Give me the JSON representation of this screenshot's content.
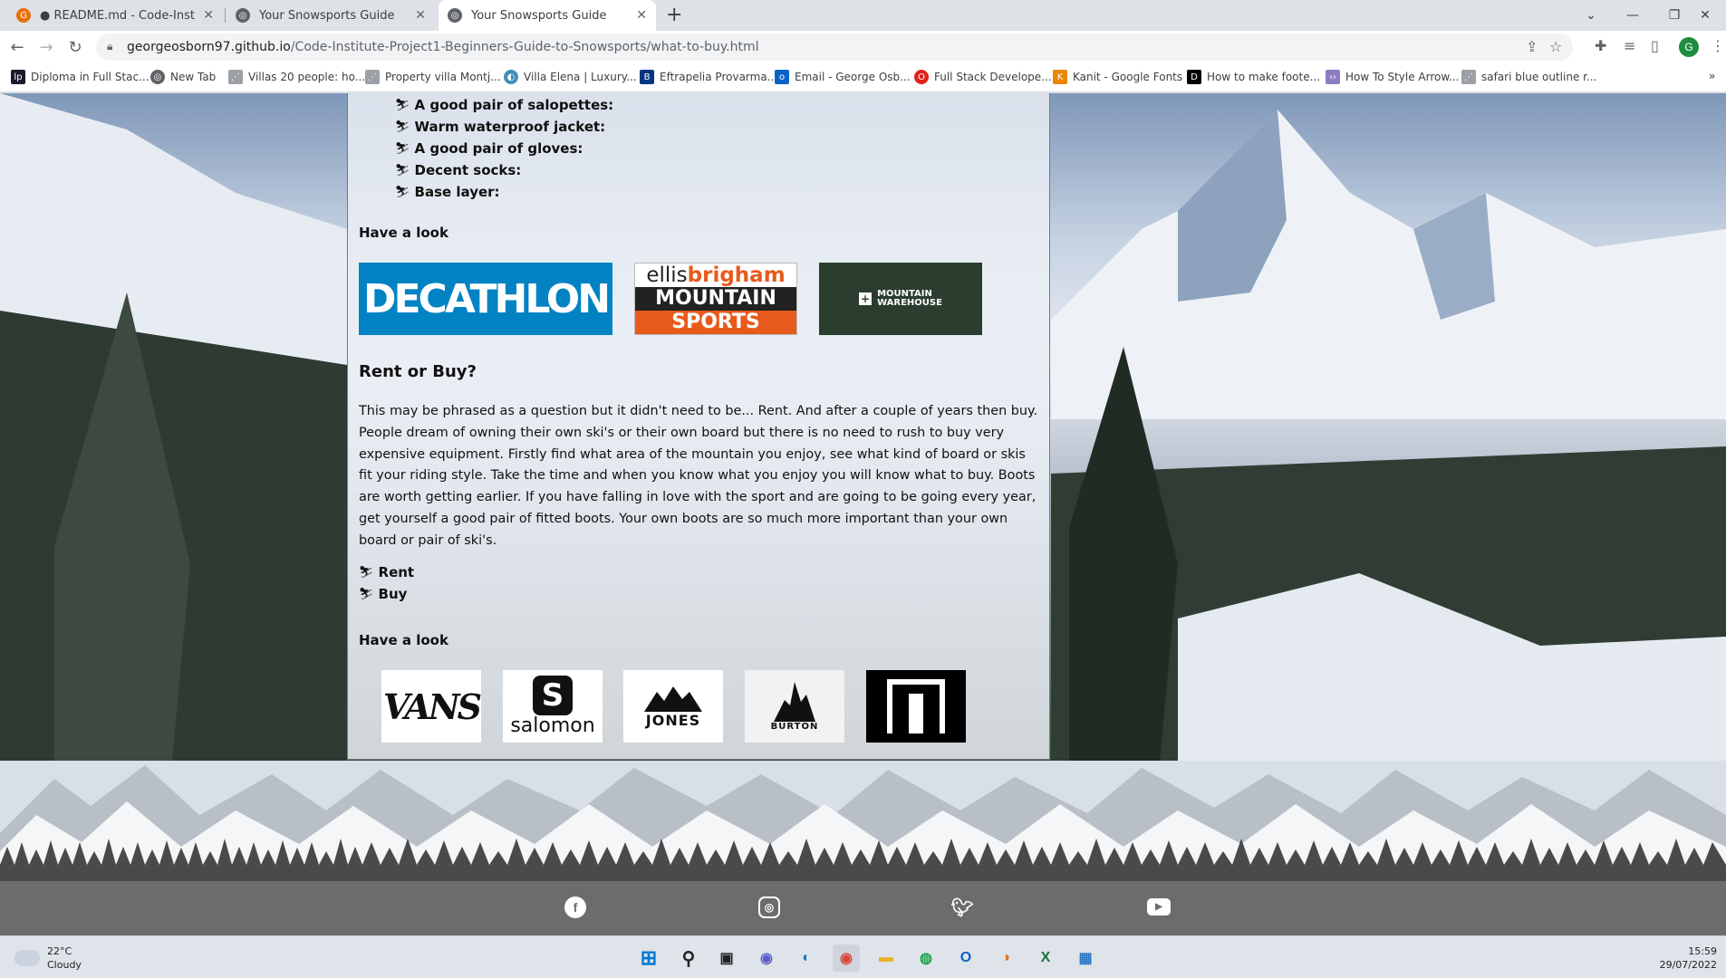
{
  "browser": {
    "tabs": [
      {
        "title": "● README.md - Code-Institute-P",
        "active": false
      },
      {
        "title": "Your Snowsports Guide",
        "active": false
      },
      {
        "title": "Your Snowsports Guide",
        "active": true
      }
    ],
    "url_host": "georgeosborn97.github.io",
    "url_path": "/Code-Institute-Project1-Beginners-Guide-to-Snowsports/what-to-buy.html",
    "profile_initial": "G",
    "bookmarks": [
      "Diploma in Full Stac...",
      "New Tab",
      "Villas 20 people: ho...",
      "Property villa Montj...",
      "Villa Elena | Luxury...",
      "Eftrapelia Provarma...",
      "Email - George Osb...",
      "Full Stack Develope...",
      "Kanit - Google Fonts",
      "How to make foote...",
      "How To Style Arrow...",
      "safari blue outline r..."
    ]
  },
  "page": {
    "clothing_items": [
      "A good pair of salopettes:",
      "Warm waterproof jacket:",
      "A good pair of gloves:",
      "Decent socks:",
      "Base layer:"
    ],
    "have_a_look_1": "Have a look",
    "shops": {
      "decathlon": "DECATHLON",
      "ellis_top_a": "ellis",
      "ellis_top_b": "brigham",
      "ellis_mid": "MOUNTAIN",
      "ellis_bottom": "SPORTS",
      "mw_line1": "MOUNTAIN",
      "mw_line2": "WAREHOUSE"
    },
    "rent_heading": "Rent or Buy?",
    "rent_paragraph": "This may be phrased as a question but it didn't need to be... Rent. And after a couple of years then buy. People dream of owning their own ski's or their own board but there is no need to rush to buy very expensive equipment. Firstly find what area of the mountain you enjoy, see what kind of board or skis fit your riding style. Take the time and when you know what you enjoy you will know what to buy. Boots are worth getting earlier. If you have falling in love with the sport and are going to be going every year, get yourself a good pair of fitted boots. Your own boots are so much more important than your own board or pair of ski's.",
    "rent_items": [
      "Rent",
      "Buy"
    ],
    "have_a_look_2": "Have a look",
    "brands": {
      "vans": "VANS",
      "salomon": "salomon",
      "jones": "JONES",
      "burton": "BURTON"
    }
  },
  "footer": {
    "social_icons": [
      "facebook-icon",
      "instagram-icon",
      "twitter-icon",
      "youtube-icon"
    ]
  },
  "taskbar": {
    "temperature": "22°C",
    "condition": "Cloudy",
    "time": "15:59",
    "date": "29/07/2022"
  },
  "colors": {
    "decathlon_blue": "#0082c3",
    "ellis_orange": "#e85a1b",
    "mountain_warehouse_green": "#2a3d2e",
    "footer_grey": "#6c6c6c"
  }
}
